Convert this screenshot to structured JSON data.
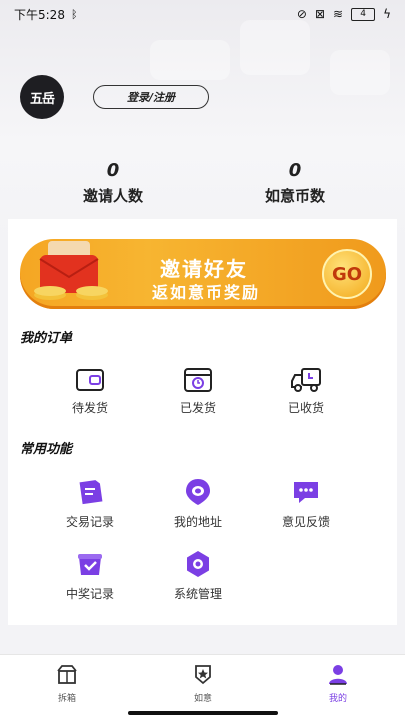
{
  "status_bar": {
    "time": "下午5:28",
    "battery": "4"
  },
  "profile": {
    "avatar_text": "五岳",
    "login_button": "登录/注册"
  },
  "stats": [
    {
      "value": "0",
      "label": "邀请人数"
    },
    {
      "value": "0",
      "label": "如意币数"
    }
  ],
  "banner": {
    "title": "邀请好友",
    "subtitle": "返如意币奖励",
    "go": "GO"
  },
  "orders": {
    "title": "我的订单",
    "items": [
      {
        "label": "待发货",
        "icon": "wallet-icon"
      },
      {
        "label": "已发货",
        "icon": "clock-box-icon"
      },
      {
        "label": "已收货",
        "icon": "truck-icon"
      }
    ]
  },
  "functions": {
    "title": "常用功能",
    "items": [
      {
        "label": "交易记录",
        "icon": "document-icon"
      },
      {
        "label": "我的地址",
        "icon": "location-icon"
      },
      {
        "label": "意见反馈",
        "icon": "chat-icon"
      },
      {
        "label": "中奖记录",
        "icon": "prize-box-icon"
      },
      {
        "label": "系统管理",
        "icon": "hex-settings-icon"
      }
    ]
  },
  "tabbar": {
    "items": [
      {
        "label": "拆箱",
        "icon": "box-icon"
      },
      {
        "label": "如意",
        "icon": "shield-star-icon"
      },
      {
        "label": "我的",
        "icon": "user-icon"
      }
    ],
    "active_color": "#7b3fe4"
  },
  "colors": {
    "accent": "#7b3fe4",
    "banner": "#f5a623"
  }
}
